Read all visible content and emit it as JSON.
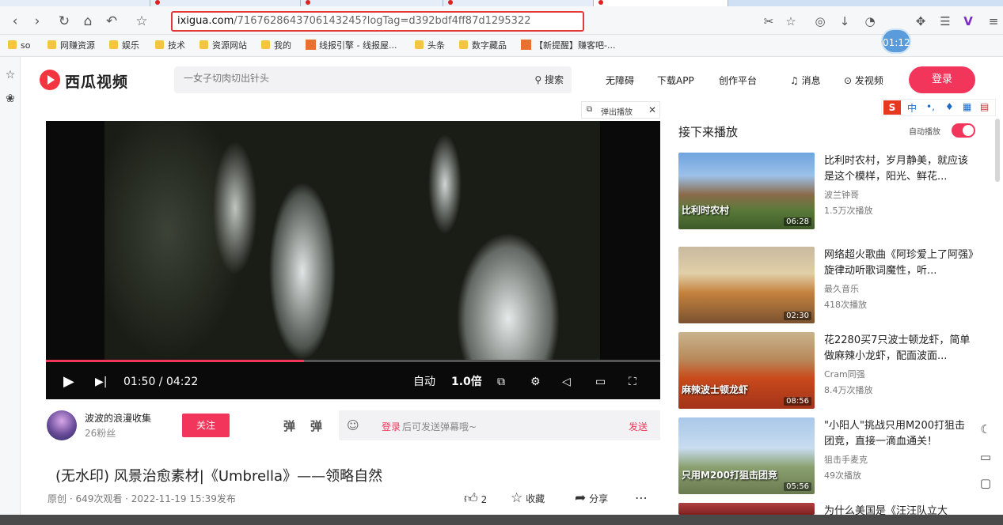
{
  "browser": {
    "url_host": "ixigua.com",
    "url_path": "/7167628643706143245?logTag=d392bdf4ff87d1295322",
    "bookmarks": [
      {
        "label": "so",
        "kind": "folder"
      },
      {
        "label": "网赚资源",
        "kind": "folder"
      },
      {
        "label": "娱乐",
        "kind": "folder"
      },
      {
        "label": "技术",
        "kind": "folder"
      },
      {
        "label": "资源网站",
        "kind": "folder"
      },
      {
        "label": "我的",
        "kind": "folder"
      },
      {
        "label": "线报引擎 - 线报屋...",
        "kind": "site"
      },
      {
        "label": "头条",
        "kind": "folder"
      },
      {
        "label": "数字藏品",
        "kind": "folder"
      },
      {
        "label": "【新提醒】赚客吧-...",
        "kind": "site"
      }
    ],
    "clock": "01:12"
  },
  "site": {
    "logo_text": "西瓜视频",
    "search_placeholder": "一女子切肉切出针头",
    "search_button": "搜索",
    "nav": [
      "无障碍",
      "下载APP",
      "创作平台"
    ],
    "messages": "消息",
    "publish": "发视频",
    "login": "登录"
  },
  "player": {
    "popout_label": "弹出播放",
    "current_time": "01:50",
    "total_time": "04:22",
    "time_display": "01:50 / 04:22",
    "quality": "自动",
    "speed": "1.0倍",
    "progress": 0.42
  },
  "author": {
    "name": "波波的浪漫收集",
    "fans": "26粉丝",
    "follow": "关注",
    "danmu_login": "登录",
    "danmu_placeholder": "后可发送弹幕哦~",
    "danmu_send": "发送"
  },
  "video": {
    "title": "(无水印) 风景治愈素材|《Umbrella》——领略自然",
    "meta": "原创 · 649次观看 · 2022-11-19 15:39发布",
    "likes": "2",
    "collect": "收藏",
    "share": "分享"
  },
  "upnext": {
    "heading": "接下来播放",
    "autoplay_label": "自动播放",
    "autoplay_on": true,
    "items": [
      {
        "title": "比利时农村，岁月静美，就应该是这个模样，阳光、鲜花...",
        "author": "波兰钟哥",
        "views": "1.5万次播放",
        "duration": "06:28",
        "caption": "比利时农村"
      },
      {
        "title": "网络超火歌曲《阿珍爱上了阿强》旋律动听歌词魔性，听...",
        "author": "最久音乐",
        "views": "418次播放",
        "duration": "02:30",
        "caption": ""
      },
      {
        "title": "花2280买7只波士顿龙虾，简单做麻辣小龙虾，配面波面...",
        "author": "Cram同强",
        "views": "8.4万次播放",
        "duration": "08:56",
        "caption": "麻辣波士顿龙虾"
      },
      {
        "title": "\"小阳人\"挑战只用M200打狙击团竞，直接一滴血通关！",
        "author": "狙击手麦克",
        "views": "49次播放",
        "duration": "05:56",
        "caption": "只用M200打狙击团竞"
      },
      {
        "title": "为什么美国是《汪汪队立大",
        "author": "",
        "views": "",
        "duration": "",
        "caption": ""
      }
    ]
  },
  "ime": {
    "label": "中"
  }
}
